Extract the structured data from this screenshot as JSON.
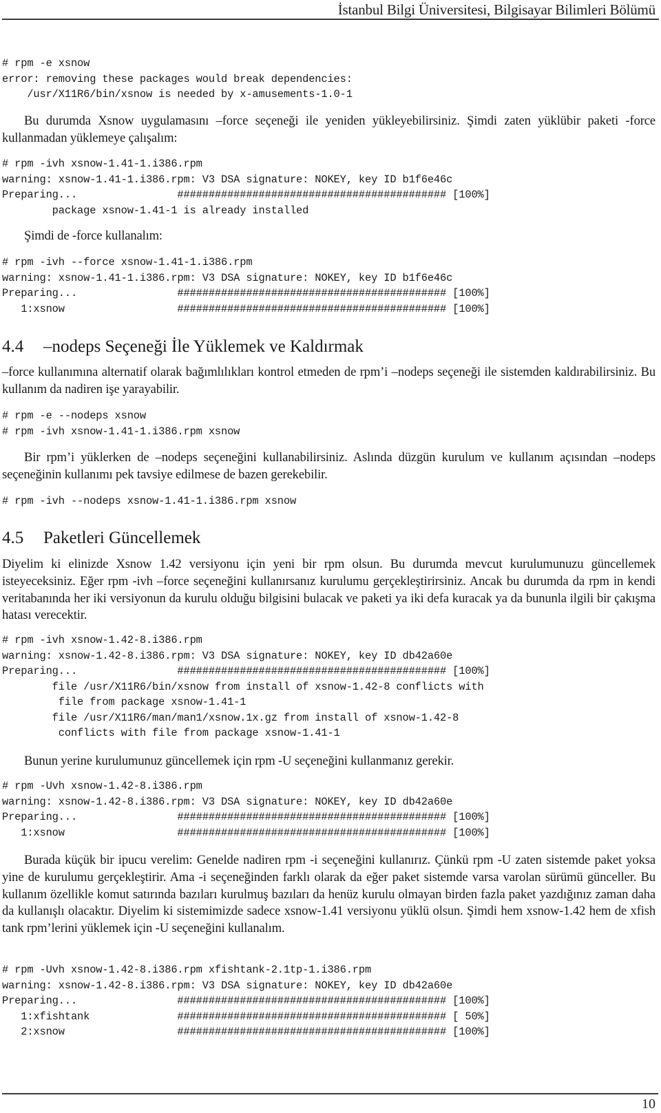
{
  "header": {
    "running_title": "İstanbul Bilgi Üniversitesi, Bilgisayar Bilimleri Bölümü"
  },
  "footer": {
    "page_number": "10"
  },
  "content": {
    "code1": "# rpm -e xsnow\nerror: removing these packages would break dependencies:\n    /usr/X11R6/bin/xsnow is needed by x-amusements-1.0-1",
    "para1": "Bu durumda Xsnow uygulamasını –force seçeneği ile yeniden yükleyebilirsiniz. Şimdi zaten yüklübir paketi -force kullanmadan yüklemeye çalışalım:",
    "code2": "# rpm -ivh xsnow-1.41-1.i386.rpm\nwarning: xsnow-1.41-1.i386.rpm: V3 DSA signature: NOKEY, key ID b1f6e46c\nPreparing...                ########################################### [100%]\n        package xsnow-1.41-1 is already installed",
    "para2": "Şimdi de -force kullanalım:",
    "code3": "# rpm -ivh --force xsnow-1.41-1.i386.rpm\nwarning: xsnow-1.41-1.i386.rpm: V3 DSA signature: NOKEY, key ID b1f6e46c\nPreparing...                ########################################### [100%]\n   1:xsnow                  ########################################### [100%]",
    "section_4_4": {
      "number": "4.4",
      "title": "–nodeps Seçeneği İle Yüklemek ve Kaldırmak"
    },
    "para3": "–force kullanımına alternatif olarak bağımlılıkları kontrol etmeden de rpm’i –nodeps seçeneği ile sistemden kaldırabilirsiniz. Bu kullanım da nadiren işe yarayabilir.",
    "code4": "# rpm -e --nodeps xsnow\n# rpm -ivh xsnow-1.41-1.i386.rpm xsnow",
    "para4": "Bir rpm’i yüklerken de –nodeps seçeneğini kullanabilirsiniz. Aslında düzgün kurulum ve kullanım açısından –nodeps seçeneğinin kullanımı pek tavsiye edilmese de bazen gerekebilir.",
    "code5": "# rpm -ivh --nodeps xsnow-1.41-1.i386.rpm xsnow",
    "section_4_5": {
      "number": "4.5",
      "title": "Paketleri Güncellemek"
    },
    "para5": "Diyelim ki elinizde Xsnow 1.42 versiyonu için yeni bir rpm olsun. Bu durumda mevcut kurulumunuzu güncellemek isteyeceksiniz. Eğer rpm -ivh –force seçeneğini kullanırsanız kurulumu gerçekleştirirsiniz. Ancak bu durumda da rpm in kendi veritabanında her iki versiyonun da kurulu olduğu bilgisini bulacak ve paketi ya iki defa kuracak ya da bununla ilgili bir çakışma hatası verecektir.",
    "code6": "# rpm -ivh xsnow-1.42-8.i386.rpm\nwarning: xsnow-1.42-8.i386.rpm: V3 DSA signature: NOKEY, key ID db42a60e\nPreparing...                ########################################### [100%]\n        file /usr/X11R6/bin/xsnow from install of xsnow-1.42-8 conflicts with\n         file from package xsnow-1.41-1\n        file /usr/X11R6/man/man1/xsnow.1x.gz from install of xsnow-1.42-8\n         conflicts with file from package xsnow-1.41-1",
    "para6": "Bunun yerine kurulumunuz güncellemek için rpm -U seçeneğini kullanmanız gerekir.",
    "code7": "# rpm -Uvh xsnow-1.42-8.i386.rpm\nwarning: xsnow-1.42-8.i386.rpm: V3 DSA signature: NOKEY, key ID db42a60e\nPreparing...                ########################################### [100%]\n   1:xsnow                  ########################################### [100%]",
    "para7": "Burada küçük bir ipucu verelim: Genelde nadiren rpm -i seçeneğini kullanırız. Çünkü rpm -U zaten sistemde paket yoksa yine de kurulumu gerçekleştirir. Ama -i seçeneğinden farklı olarak da eğer paket sistemde varsa varolan sürümü günceller. Bu kullanım özellikle komut satırında bazıları kurulmuş bazıları da henüz kurulu olmayan birden fazla paket yazdığınız zaman daha da kullanışlı olacaktır. Diyelim ki sistemimizde sadece xsnow-1.41 versiyonu yüklü olsun. Şimdi hem xsnow-1.42 hem de xfish tank rpm’lerini yüklemek için -U seçeneğini kullanalım.",
    "code8": "# rpm -Uvh xsnow-1.42-8.i386.rpm xfishtank-2.1tp-1.i386.rpm\nwarning: xsnow-1.42-8.i386.rpm: V3 DSA signature: NOKEY, key ID db42a60e\nPreparing...                ########################################### [100%]\n   1:xfishtank              ########################################### [ 50%]\n   2:xsnow                  ########################################### [100%]"
  }
}
